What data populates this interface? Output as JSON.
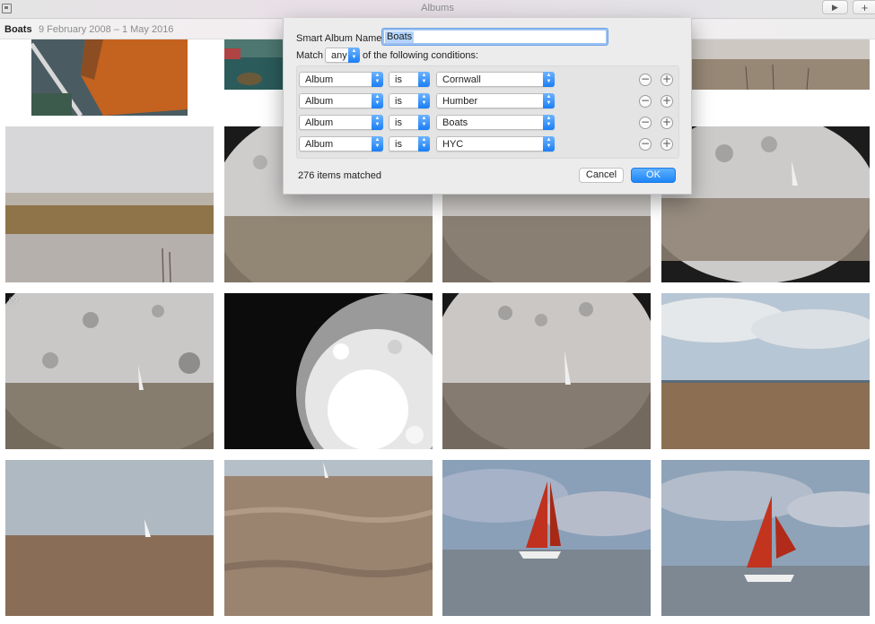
{
  "window": {
    "title": "Albums"
  },
  "toolbar": {
    "play_icon": "play-icon",
    "add_icon": "plus-icon",
    "play_glyph": "▶",
    "add_glyph": "+"
  },
  "header": {
    "album_name": "Boats",
    "date_range": "9 February 2008 – 1 May 2016"
  },
  "dialog": {
    "name_label": "Smart Album Name:",
    "name_value": "Boats",
    "match_label": "Match",
    "match_value": "any",
    "match_suffix": "of the following conditions:",
    "conditions": [
      {
        "field": "Album",
        "operator": "is",
        "value": "Cornwall"
      },
      {
        "field": "Album",
        "operator": "is",
        "value": "Humber"
      },
      {
        "field": "Album",
        "operator": "is",
        "value": "Boats"
      },
      {
        "field": "Album",
        "operator": "is",
        "value": "HYC"
      }
    ],
    "remove_glyph": "−",
    "add_glyph": "+",
    "items_matched": "276 items matched",
    "cancel_label": "Cancel",
    "ok_label": "OK"
  },
  "photos": [
    {
      "favorite": false
    },
    {
      "favorite": false
    },
    {
      "favorite": false
    },
    {
      "favorite": false
    },
    {
      "favorite": false
    },
    {
      "favorite": false
    },
    {
      "favorite": false
    },
    {
      "favorite": true
    },
    {
      "favorite": false
    },
    {
      "favorite": false
    },
    {
      "favorite": false
    },
    {
      "favorite": false
    },
    {
      "favorite": false
    },
    {
      "favorite": false
    },
    {
      "favorite": false
    }
  ],
  "heart_glyph": "♡"
}
